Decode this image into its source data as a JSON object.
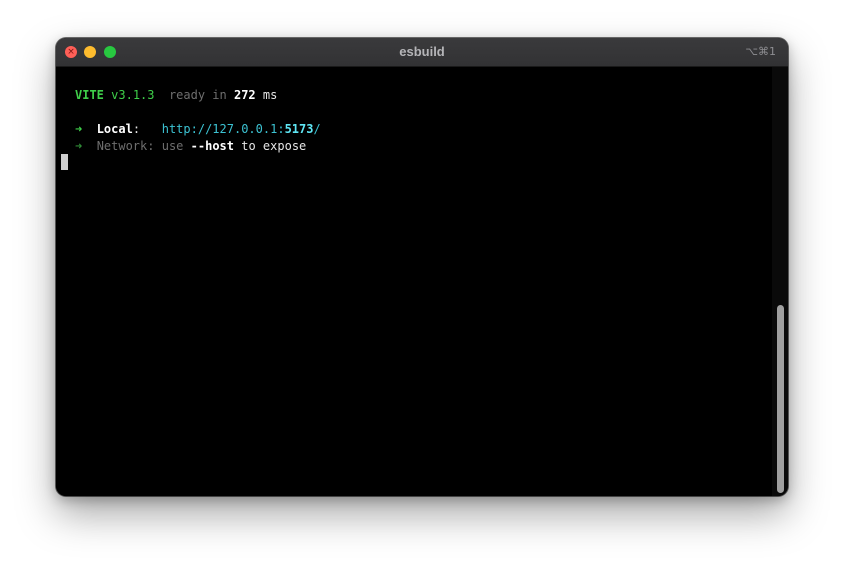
{
  "window": {
    "title": "esbuild",
    "shortcut": "⌥⌘1",
    "close_glyph": "×"
  },
  "terminal": {
    "banner": {
      "name": "VITE",
      "version": "v3.1.3",
      "ready_text": "ready in",
      "time": "272",
      "unit": "ms"
    },
    "local": {
      "arrow": "➜",
      "label": "Local",
      "colon": ":",
      "url_prefix": "http://127.0.0.1:",
      "port": "5173",
      "url_suffix": "/"
    },
    "network": {
      "arrow": "➜",
      "label": "Network",
      "colon": ":",
      "use_text": "use",
      "flag": "--host",
      "rest": "to expose"
    }
  },
  "colors": {
    "green": "#3fcf4a",
    "cyan": "#3cc3d3",
    "close": "#ff5f57",
    "minimize": "#febc2e",
    "zoom": "#28c840"
  }
}
